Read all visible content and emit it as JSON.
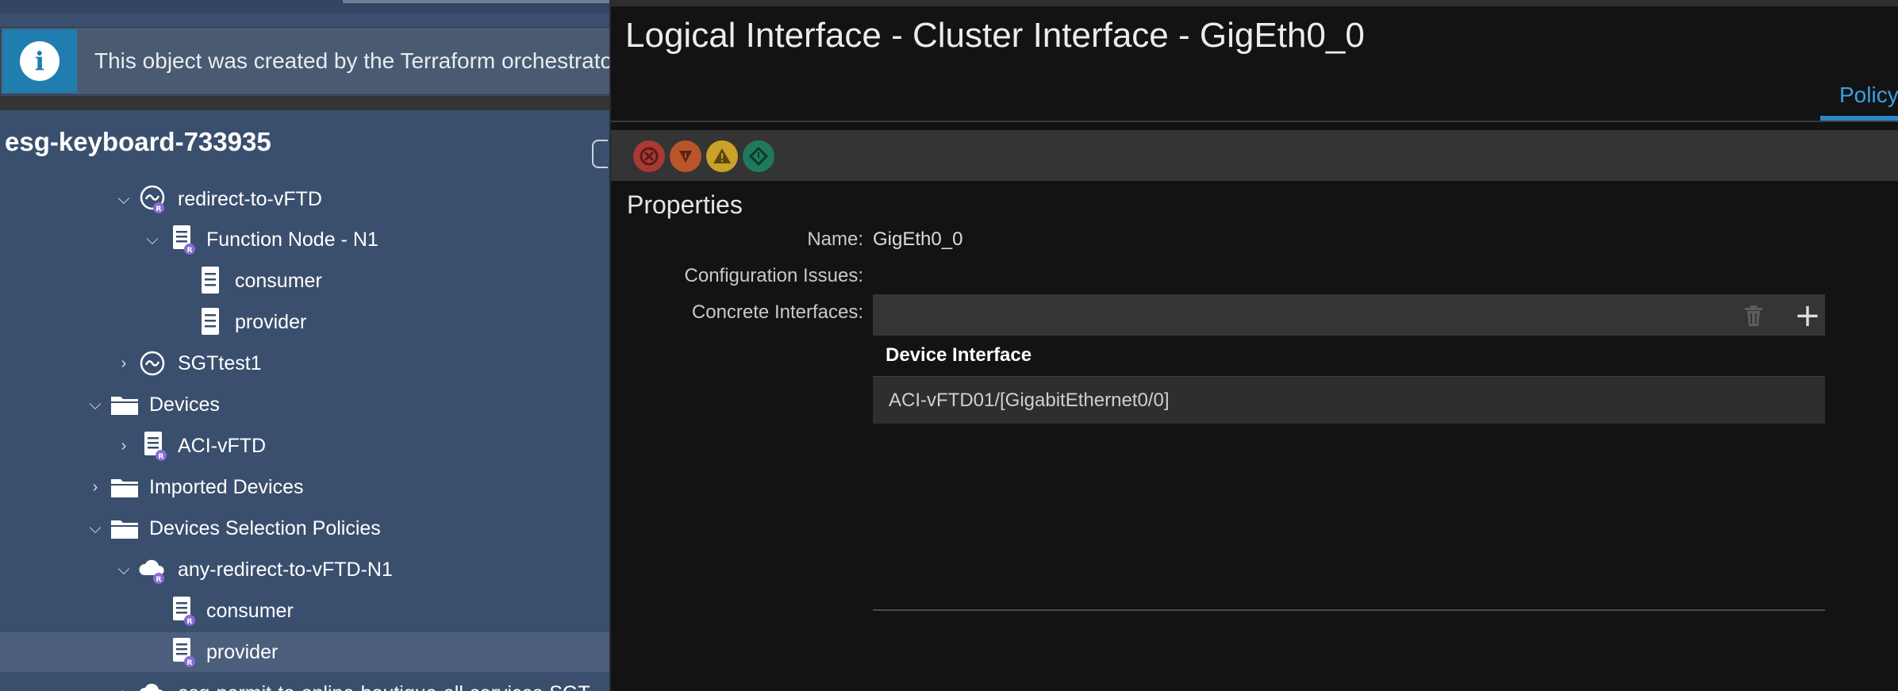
{
  "banner": {
    "icon": "info-icon",
    "text": "This object was created by the Terraform orchestrator"
  },
  "tenant": {
    "title": "esg-keyboard-733935"
  },
  "tree": [
    {
      "label": "redirect-to-vFTD",
      "icon": "service-graph-icon",
      "expanded": true
    },
    {
      "label": "Function Node - N1",
      "icon": "document-icon",
      "expanded": true
    },
    {
      "label": "consumer",
      "icon": "document-icon"
    },
    {
      "label": "provider",
      "icon": "document-icon"
    },
    {
      "label": "SGTtest1",
      "icon": "service-graph-icon",
      "expanded": false
    },
    {
      "label": "Devices",
      "icon": "folder-icon",
      "expanded": true
    },
    {
      "label": "ACI-vFTD",
      "icon": "document-icon",
      "expanded": false
    },
    {
      "label": "Imported Devices",
      "icon": "folder-icon",
      "expanded": false
    },
    {
      "label": "Devices Selection Policies",
      "icon": "folder-icon",
      "expanded": true
    },
    {
      "label": "any-redirect-to-vFTD-N1",
      "icon": "cloud-icon",
      "expanded": true
    },
    {
      "label": "consumer",
      "icon": "document-icon"
    },
    {
      "label": "provider",
      "icon": "document-icon",
      "selected": true
    },
    {
      "label": "esg-permit-to-online-boutique-all-services-SGT",
      "icon": "cloud-icon",
      "expanded": false
    }
  ],
  "panel": {
    "title": "Logical Interface - Cluster Interface - GigEth0_0",
    "tabs": [
      {
        "label": "Policy",
        "active": true
      }
    ],
    "faults": [
      {
        "name": "critical-fault-icon",
        "color": "#c0392b"
      },
      {
        "name": "major-fault-icon",
        "color": "#d35400"
      },
      {
        "name": "minor-fault-icon",
        "color": "#e6b800"
      },
      {
        "name": "warning-fault-icon",
        "color": "#16a085"
      }
    ],
    "properties": {
      "title": "Properties",
      "name_label": "Name:",
      "name_value": "GigEth0_0",
      "config_issues_label": "Configuration Issues:",
      "config_issues_value": "",
      "concrete_interfaces_label": "Concrete Interfaces:"
    },
    "concrete_interfaces": {
      "columns": [
        "Device Interface"
      ],
      "rows": [
        [
          "ACI-vFTD01/[GigabitEthernet0/0]"
        ]
      ]
    }
  }
}
